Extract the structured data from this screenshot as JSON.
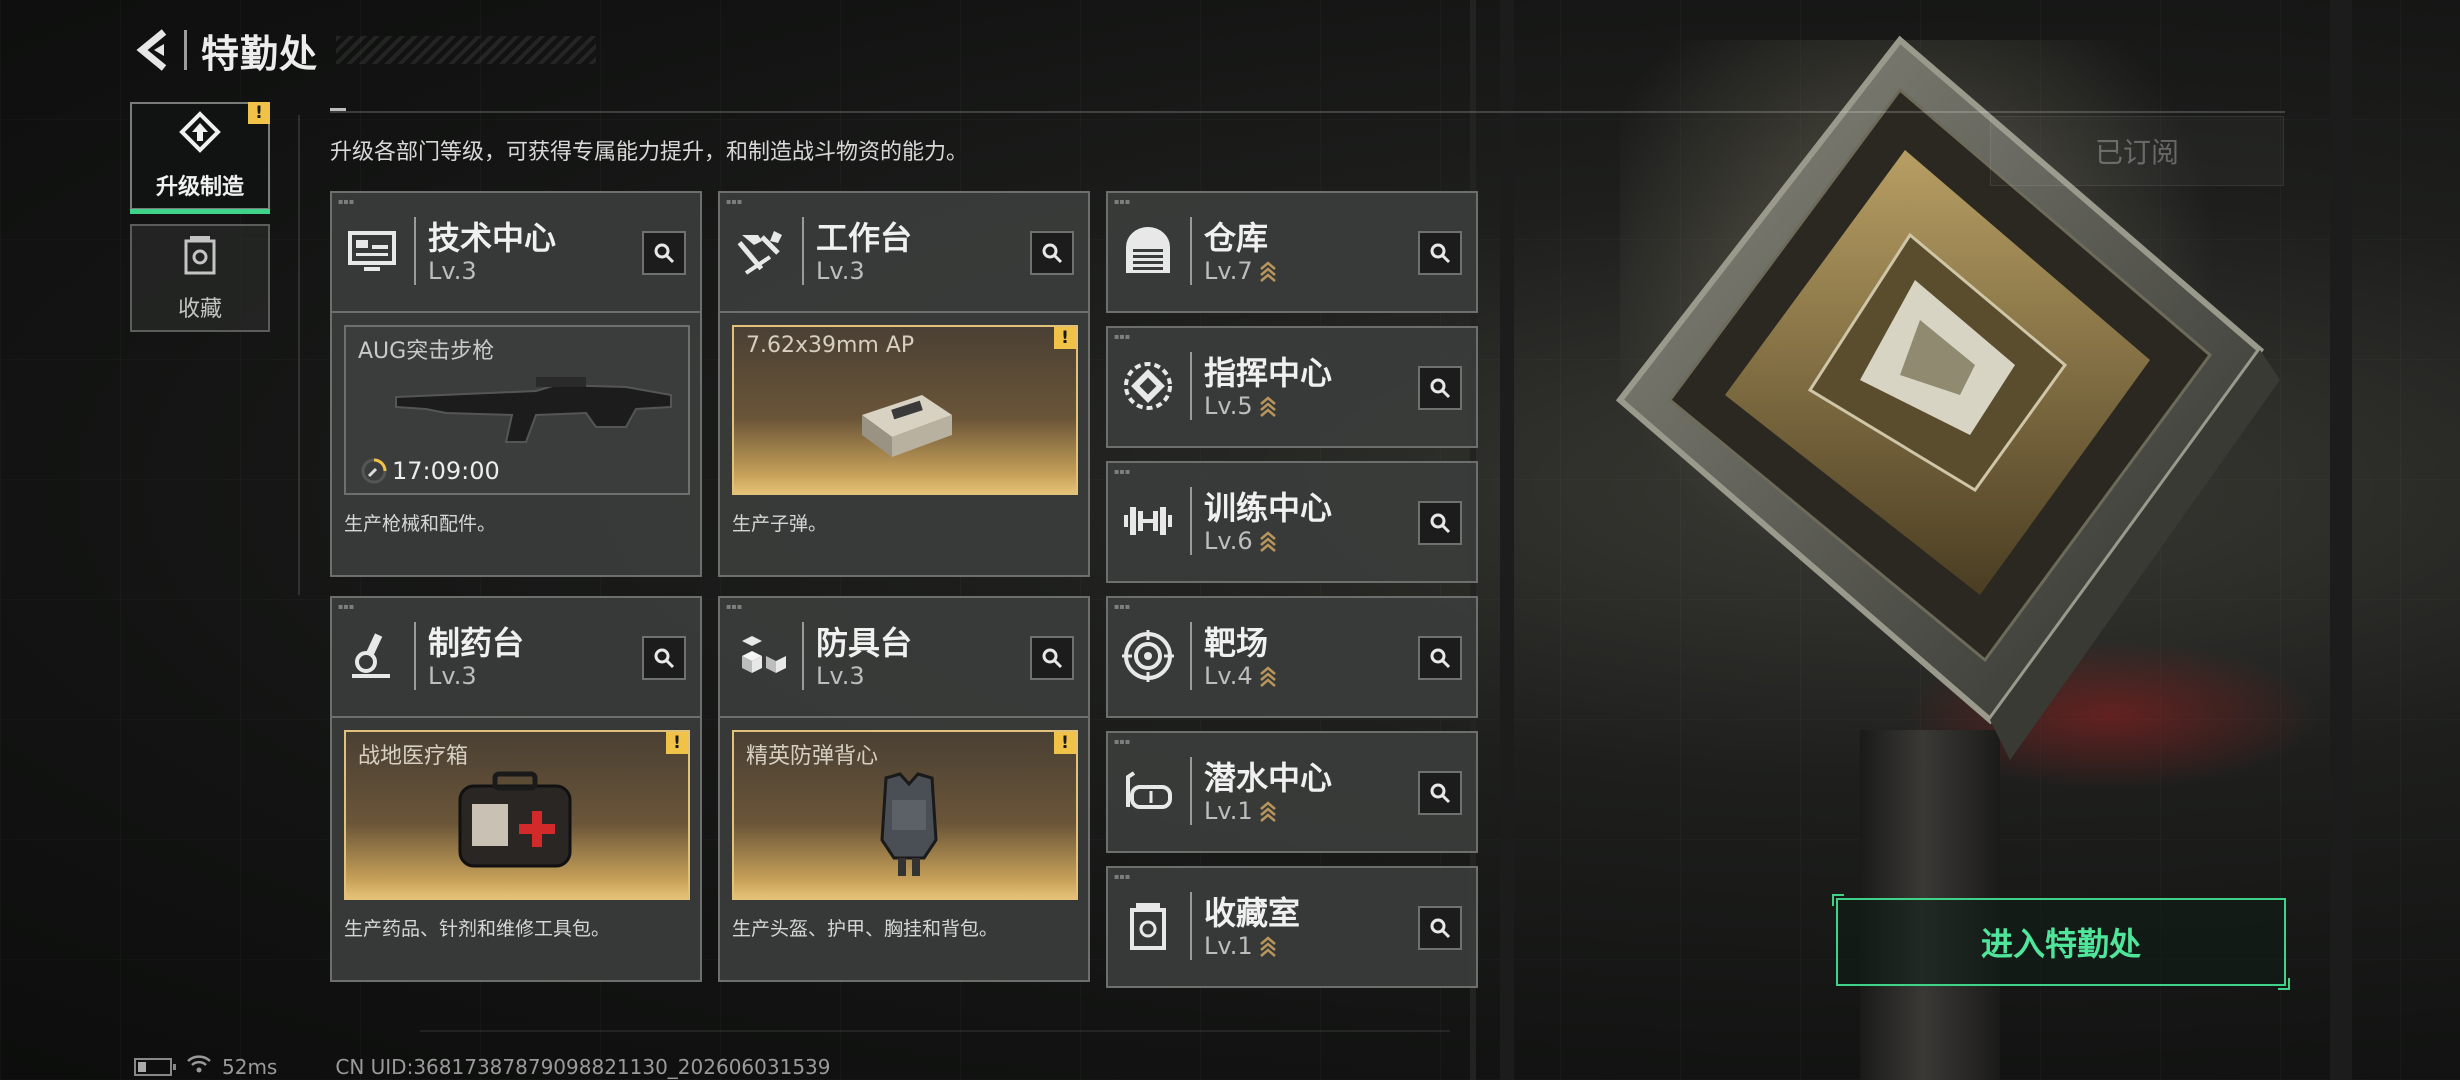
{
  "header": {
    "title": "特勤处"
  },
  "nav": {
    "tabs": [
      {
        "label": "升级制造",
        "active": true,
        "badge": "!"
      },
      {
        "label": "收藏",
        "active": false
      }
    ]
  },
  "description": "升级各部门等级，可获得专属能力提升，和制造战斗物资的能力。",
  "subscribed_label": "已订阅",
  "departments": [
    {
      "name": "技术中心",
      "level": "Lv.3",
      "icon": "tech-center-icon"
    },
    {
      "name": "工作台",
      "level": "Lv.3",
      "icon": "hammer-icon"
    },
    {
      "name": "仓库",
      "level": "Lv.7",
      "icon": "warehouse-icon"
    },
    {
      "name": "指挥中心",
      "level": "Lv.5",
      "icon": "chip-icon"
    },
    {
      "name": "训练中心",
      "level": "Lv.6",
      "icon": "dumbbell-icon"
    },
    {
      "name": "制药台",
      "level": "Lv.3",
      "icon": "microscope-icon"
    },
    {
      "name": "防具台",
      "level": "Lv.3",
      "icon": "cubes-icon"
    },
    {
      "name": "靶场",
      "level": "Lv.4",
      "icon": "target-icon"
    },
    {
      "name": "潜水中心",
      "level": "Lv.1",
      "icon": "dive-mask-icon"
    },
    {
      "name": "收藏室",
      "level": "Lv.1",
      "icon": "collection-icon"
    }
  ],
  "productions": [
    {
      "title": "AUG突击步枪",
      "timer": "17:09:00",
      "desc": "生产枪械和配件。",
      "state": "producing"
    },
    {
      "title": "7.62x39mm AP",
      "desc": "生产子弹。",
      "state": "ready",
      "badge": "!"
    },
    {
      "title": "战地医疗箱",
      "desc": "生产药品、针剂和维修工具包。",
      "state": "ready",
      "badge": "!"
    },
    {
      "title": "精英防弹背心",
      "desc": "生产头盔、护甲、胸挂和背包。",
      "state": "ready",
      "badge": "!"
    }
  ],
  "enter_button": "进入特勤处",
  "status": {
    "ping": "52ms",
    "uid": "CN UID:3681738787909882113​0_202606031539"
  },
  "colors": {
    "accent_green": "#3fd38a",
    "warning_yellow": "#f1c248",
    "gold": "#e2c27a"
  }
}
